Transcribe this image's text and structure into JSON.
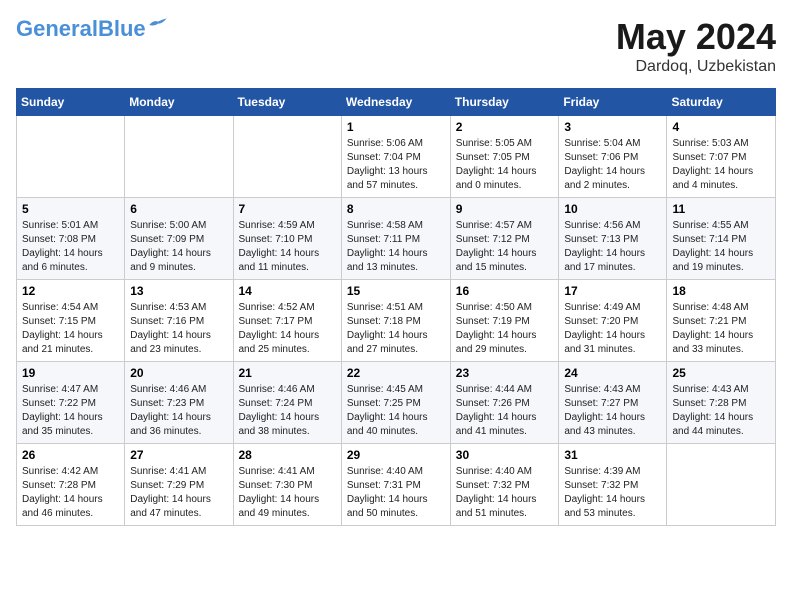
{
  "header": {
    "logo_general": "General",
    "logo_blue": "Blue",
    "month": "May 2024",
    "location": "Dardoq, Uzbekistan"
  },
  "weekdays": [
    "Sunday",
    "Monday",
    "Tuesday",
    "Wednesday",
    "Thursday",
    "Friday",
    "Saturday"
  ],
  "weeks": [
    [
      {
        "day": "",
        "info": ""
      },
      {
        "day": "",
        "info": ""
      },
      {
        "day": "",
        "info": ""
      },
      {
        "day": "1",
        "info": "Sunrise: 5:06 AM\nSunset: 7:04 PM\nDaylight: 13 hours and 57 minutes."
      },
      {
        "day": "2",
        "info": "Sunrise: 5:05 AM\nSunset: 7:05 PM\nDaylight: 14 hours and 0 minutes."
      },
      {
        "day": "3",
        "info": "Sunrise: 5:04 AM\nSunset: 7:06 PM\nDaylight: 14 hours and 2 minutes."
      },
      {
        "day": "4",
        "info": "Sunrise: 5:03 AM\nSunset: 7:07 PM\nDaylight: 14 hours and 4 minutes."
      }
    ],
    [
      {
        "day": "5",
        "info": "Sunrise: 5:01 AM\nSunset: 7:08 PM\nDaylight: 14 hours and 6 minutes."
      },
      {
        "day": "6",
        "info": "Sunrise: 5:00 AM\nSunset: 7:09 PM\nDaylight: 14 hours and 9 minutes."
      },
      {
        "day": "7",
        "info": "Sunrise: 4:59 AM\nSunset: 7:10 PM\nDaylight: 14 hours and 11 minutes."
      },
      {
        "day": "8",
        "info": "Sunrise: 4:58 AM\nSunset: 7:11 PM\nDaylight: 14 hours and 13 minutes."
      },
      {
        "day": "9",
        "info": "Sunrise: 4:57 AM\nSunset: 7:12 PM\nDaylight: 14 hours and 15 minutes."
      },
      {
        "day": "10",
        "info": "Sunrise: 4:56 AM\nSunset: 7:13 PM\nDaylight: 14 hours and 17 minutes."
      },
      {
        "day": "11",
        "info": "Sunrise: 4:55 AM\nSunset: 7:14 PM\nDaylight: 14 hours and 19 minutes."
      }
    ],
    [
      {
        "day": "12",
        "info": "Sunrise: 4:54 AM\nSunset: 7:15 PM\nDaylight: 14 hours and 21 minutes."
      },
      {
        "day": "13",
        "info": "Sunrise: 4:53 AM\nSunset: 7:16 PM\nDaylight: 14 hours and 23 minutes."
      },
      {
        "day": "14",
        "info": "Sunrise: 4:52 AM\nSunset: 7:17 PM\nDaylight: 14 hours and 25 minutes."
      },
      {
        "day": "15",
        "info": "Sunrise: 4:51 AM\nSunset: 7:18 PM\nDaylight: 14 hours and 27 minutes."
      },
      {
        "day": "16",
        "info": "Sunrise: 4:50 AM\nSunset: 7:19 PM\nDaylight: 14 hours and 29 minutes."
      },
      {
        "day": "17",
        "info": "Sunrise: 4:49 AM\nSunset: 7:20 PM\nDaylight: 14 hours and 31 minutes."
      },
      {
        "day": "18",
        "info": "Sunrise: 4:48 AM\nSunset: 7:21 PM\nDaylight: 14 hours and 33 minutes."
      }
    ],
    [
      {
        "day": "19",
        "info": "Sunrise: 4:47 AM\nSunset: 7:22 PM\nDaylight: 14 hours and 35 minutes."
      },
      {
        "day": "20",
        "info": "Sunrise: 4:46 AM\nSunset: 7:23 PM\nDaylight: 14 hours and 36 minutes."
      },
      {
        "day": "21",
        "info": "Sunrise: 4:46 AM\nSunset: 7:24 PM\nDaylight: 14 hours and 38 minutes."
      },
      {
        "day": "22",
        "info": "Sunrise: 4:45 AM\nSunset: 7:25 PM\nDaylight: 14 hours and 40 minutes."
      },
      {
        "day": "23",
        "info": "Sunrise: 4:44 AM\nSunset: 7:26 PM\nDaylight: 14 hours and 41 minutes."
      },
      {
        "day": "24",
        "info": "Sunrise: 4:43 AM\nSunset: 7:27 PM\nDaylight: 14 hours and 43 minutes."
      },
      {
        "day": "25",
        "info": "Sunrise: 4:43 AM\nSunset: 7:28 PM\nDaylight: 14 hours and 44 minutes."
      }
    ],
    [
      {
        "day": "26",
        "info": "Sunrise: 4:42 AM\nSunset: 7:28 PM\nDaylight: 14 hours and 46 minutes."
      },
      {
        "day": "27",
        "info": "Sunrise: 4:41 AM\nSunset: 7:29 PM\nDaylight: 14 hours and 47 minutes."
      },
      {
        "day": "28",
        "info": "Sunrise: 4:41 AM\nSunset: 7:30 PM\nDaylight: 14 hours and 49 minutes."
      },
      {
        "day": "29",
        "info": "Sunrise: 4:40 AM\nSunset: 7:31 PM\nDaylight: 14 hours and 50 minutes."
      },
      {
        "day": "30",
        "info": "Sunrise: 4:40 AM\nSunset: 7:32 PM\nDaylight: 14 hours and 51 minutes."
      },
      {
        "day": "31",
        "info": "Sunrise: 4:39 AM\nSunset: 7:32 PM\nDaylight: 14 hours and 53 minutes."
      },
      {
        "day": "",
        "info": ""
      }
    ]
  ]
}
